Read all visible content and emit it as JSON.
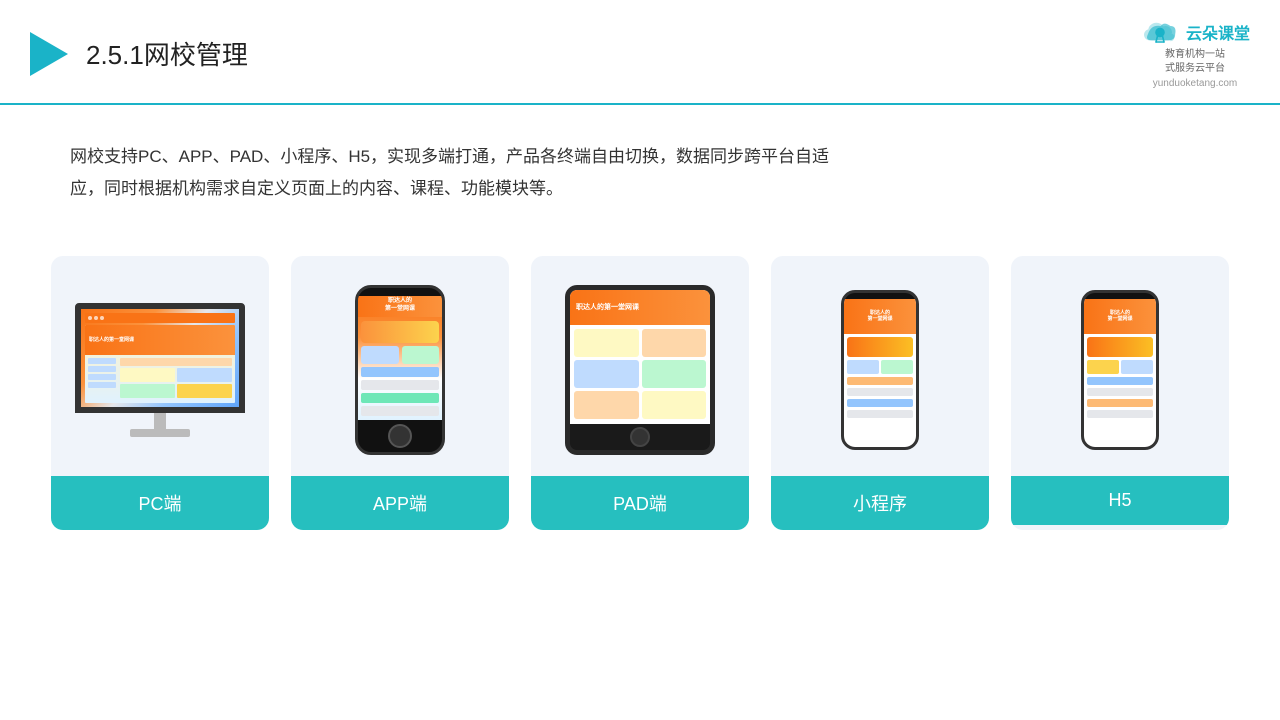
{
  "header": {
    "title_number": "2.5.1",
    "title_text": "网校管理",
    "logo_main": "云朵课堂",
    "logo_url": "yunduoketang.com",
    "logo_subtitle_line1": "教育机构一站",
    "logo_subtitle_line2": "式服务云平台"
  },
  "description": {
    "text": "网校支持PC、APP、PAD、小程序、H5，实现多端打通，产品各终端自由切换，数据同步跨平台自适应，同时根据机构需求自定义页面上的内容、课程、功能模块等。"
  },
  "cards": [
    {
      "id": "pc",
      "label": "PC端"
    },
    {
      "id": "app",
      "label": "APP端"
    },
    {
      "id": "pad",
      "label": "PAD端"
    },
    {
      "id": "miniprogram",
      "label": "小程序"
    },
    {
      "id": "h5",
      "label": "H5"
    }
  ],
  "accent_color": "#26bfbf"
}
